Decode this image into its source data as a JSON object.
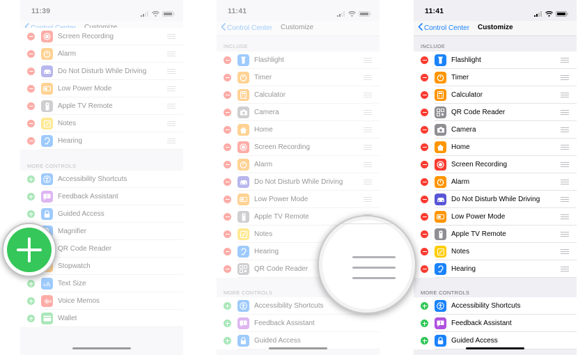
{
  "colors": {
    "accent": "#1a82fb",
    "remove": "#fb3b30",
    "add": "#34c759"
  },
  "phones": [
    {
      "time": "11:39",
      "back_label": "Control Center",
      "title": "Customize",
      "include_rows": [
        {
          "label": "Screen Recording",
          "icon": "screen-recording-icon",
          "color": "#fb3b30"
        },
        {
          "label": "Alarm",
          "icon": "alarm-icon",
          "color": "#ff9500"
        },
        {
          "label": "Do Not Disturb While Driving",
          "icon": "car-icon",
          "color": "#5856d6"
        },
        {
          "label": "Low Power Mode",
          "icon": "battery-icon",
          "color": "#ff9500"
        },
        {
          "label": "Apple TV Remote",
          "icon": "remote-icon",
          "color": "#8e8e93"
        },
        {
          "label": "Notes",
          "icon": "notes-icon",
          "color": "#ffcc00"
        },
        {
          "label": "Hearing",
          "icon": "ear-icon",
          "color": "#1a82fb"
        }
      ],
      "more_header": "MORE CONTROLS",
      "more_rows": [
        {
          "label": "Accessibility Shortcuts",
          "icon": "accessibility-icon",
          "color": "#1a82fb"
        },
        {
          "label": "Feedback Assistant",
          "icon": "feedback-icon",
          "color": "#af52de"
        },
        {
          "label": "Guided Access",
          "icon": "lock-icon",
          "color": "#1a82fb"
        },
        {
          "label": "Magnifier",
          "icon": "magnifier-icon",
          "color": "#1a82fb"
        },
        {
          "label": "QR Code Reader",
          "icon": "qr-code-icon",
          "color": "#8e8e93"
        },
        {
          "label": "Stopwatch",
          "icon": "stopwatch-icon",
          "color": "#ff9500"
        },
        {
          "label": "Text Size",
          "icon": "text-size-icon",
          "color": "#1a82fb"
        },
        {
          "label": "Voice Memos",
          "icon": "voice-memos-icon",
          "color": "#fb3b30"
        },
        {
          "label": "Wallet",
          "icon": "wallet-icon",
          "color": "#34c759"
        }
      ]
    },
    {
      "time": "11:41",
      "back_label": "Control Center",
      "title": "Customize",
      "include_header": "INCLUDE",
      "include_rows": [
        {
          "label": "Flashlight",
          "icon": "flashlight-icon",
          "color": "#1a82fb"
        },
        {
          "label": "Timer",
          "icon": "timer-icon",
          "color": "#ff9500"
        },
        {
          "label": "Calculator",
          "icon": "calculator-icon",
          "color": "#ff9500"
        },
        {
          "label": "Camera",
          "icon": "camera-icon",
          "color": "#8e8e93"
        },
        {
          "label": "Home",
          "icon": "home-icon",
          "color": "#ff9500"
        },
        {
          "label": "Screen Recording",
          "icon": "screen-recording-icon",
          "color": "#fb3b30"
        },
        {
          "label": "Alarm",
          "icon": "alarm-icon",
          "color": "#ff9500"
        },
        {
          "label": "Do Not Disturb While Driving",
          "icon": "car-icon",
          "color": "#5856d6"
        },
        {
          "label": "Low Power Mode",
          "icon": "battery-icon",
          "color": "#ff9500"
        },
        {
          "label": "Apple TV Remote",
          "icon": "remote-icon",
          "color": "#8e8e93"
        },
        {
          "label": "Notes",
          "icon": "notes-icon",
          "color": "#ffcc00"
        },
        {
          "label": "Hearing",
          "icon": "ear-icon",
          "color": "#1a82fb"
        },
        {
          "label": "QR Code Reader",
          "icon": "qr-code-icon",
          "color": "#8e8e93"
        }
      ],
      "more_header": "MORE CONTROLS",
      "more_rows": [
        {
          "label": "Accessibility Shortcuts",
          "icon": "accessibility-icon",
          "color": "#1a82fb"
        },
        {
          "label": "Feedback Assistant",
          "icon": "feedback-icon",
          "color": "#af52de"
        },
        {
          "label": "Guided Access",
          "icon": "lock-icon",
          "color": "#1a82fb"
        }
      ]
    },
    {
      "time": "11:41",
      "back_label": "Control Center",
      "title": "Customize",
      "include_header": "INCLUDE",
      "include_rows": [
        {
          "label": "Flashlight",
          "icon": "flashlight-icon",
          "color": "#1a82fb"
        },
        {
          "label": "Timer",
          "icon": "timer-icon",
          "color": "#ff9500"
        },
        {
          "label": "Calculator",
          "icon": "calculator-icon",
          "color": "#ff9500"
        },
        {
          "label": "QR Code Reader",
          "icon": "qr-code-icon",
          "color": "#8e8e93"
        },
        {
          "label": "Camera",
          "icon": "camera-icon",
          "color": "#8e8e93"
        },
        {
          "label": "Home",
          "icon": "home-icon",
          "color": "#ff9500"
        },
        {
          "label": "Screen Recording",
          "icon": "screen-recording-icon",
          "color": "#fb3b30"
        },
        {
          "label": "Alarm",
          "icon": "alarm-icon",
          "color": "#ff9500"
        },
        {
          "label": "Do Not Disturb While Driving",
          "icon": "car-icon",
          "color": "#5856d6"
        },
        {
          "label": "Low Power Mode",
          "icon": "battery-icon",
          "color": "#ff9500"
        },
        {
          "label": "Apple TV Remote",
          "icon": "remote-icon",
          "color": "#8e8e93"
        },
        {
          "label": "Notes",
          "icon": "notes-icon",
          "color": "#ffcc00"
        },
        {
          "label": "Hearing",
          "icon": "ear-icon",
          "color": "#1a82fb"
        }
      ],
      "more_header": "MORE CONTROLS",
      "more_rows": [
        {
          "label": "Accessibility Shortcuts",
          "icon": "accessibility-icon",
          "color": "#1a82fb"
        },
        {
          "label": "Feedback Assistant",
          "icon": "feedback-icon",
          "color": "#af52de"
        },
        {
          "label": "Guided Access",
          "icon": "lock-icon",
          "color": "#1a82fb"
        }
      ]
    }
  ]
}
